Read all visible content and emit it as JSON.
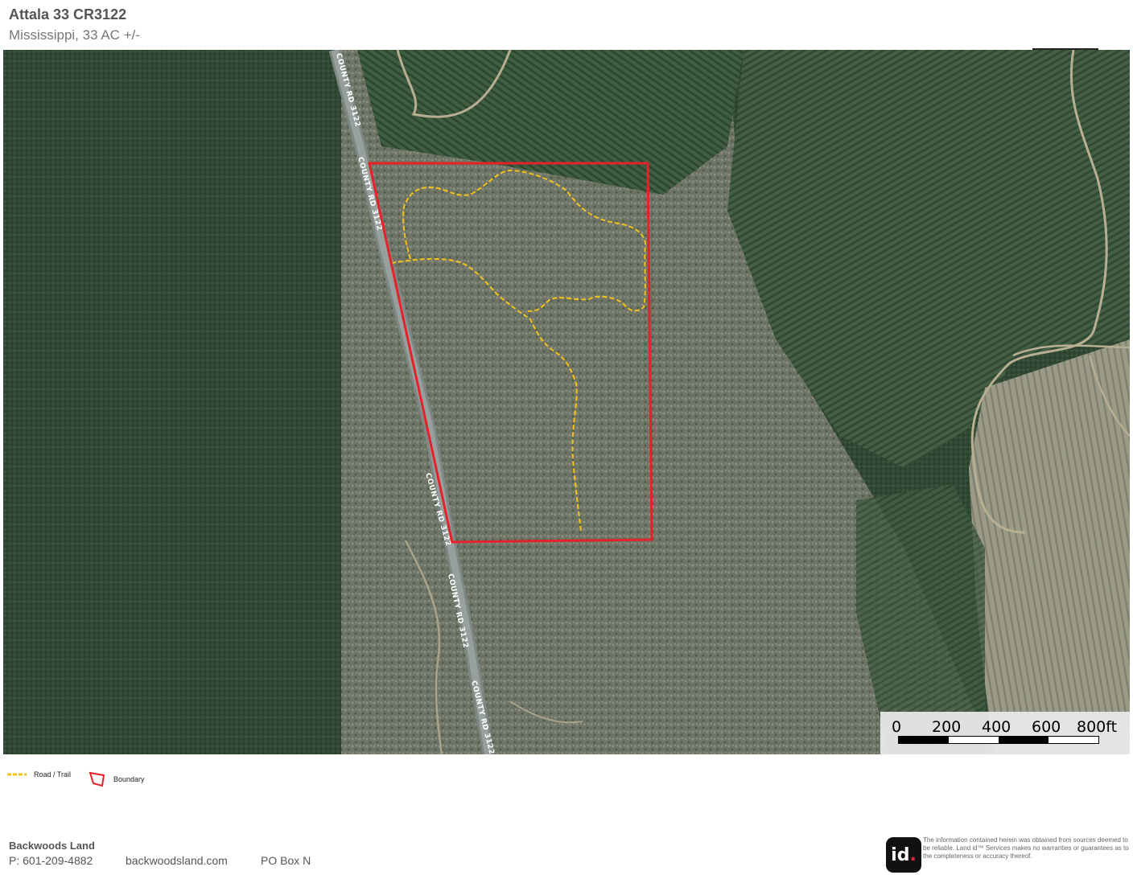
{
  "header": {
    "title": "Attala 33 CR3122",
    "subtitle": "Mississippi, 33 AC +/-"
  },
  "map": {
    "road_label": "COUNTY RD 3122",
    "colors": {
      "boundary": "#e5222b",
      "trail": "#f2c21a",
      "road": "#8a9290",
      "forest_dark": "#2d4530",
      "forest_light": "#4f6a4c",
      "hardwood": "#6f7565"
    }
  },
  "scale_bar": {
    "labels": [
      "0",
      "200",
      "400",
      "600",
      "800ft"
    ]
  },
  "legend": {
    "trail_label": "Road / Trail",
    "boundary_label": "Boundary"
  },
  "footer": {
    "company": "Backwoods Land",
    "phone": "P: 601-209-4882",
    "website": "backwoodsland.com",
    "address": "PO Box N",
    "logo_text": "id",
    "disclaimer": "The information contained herein was obtained from sources deemed to be reliable. Land id™ Services makes no warranties or guarantees as to the completeness or accuracy thereof."
  }
}
